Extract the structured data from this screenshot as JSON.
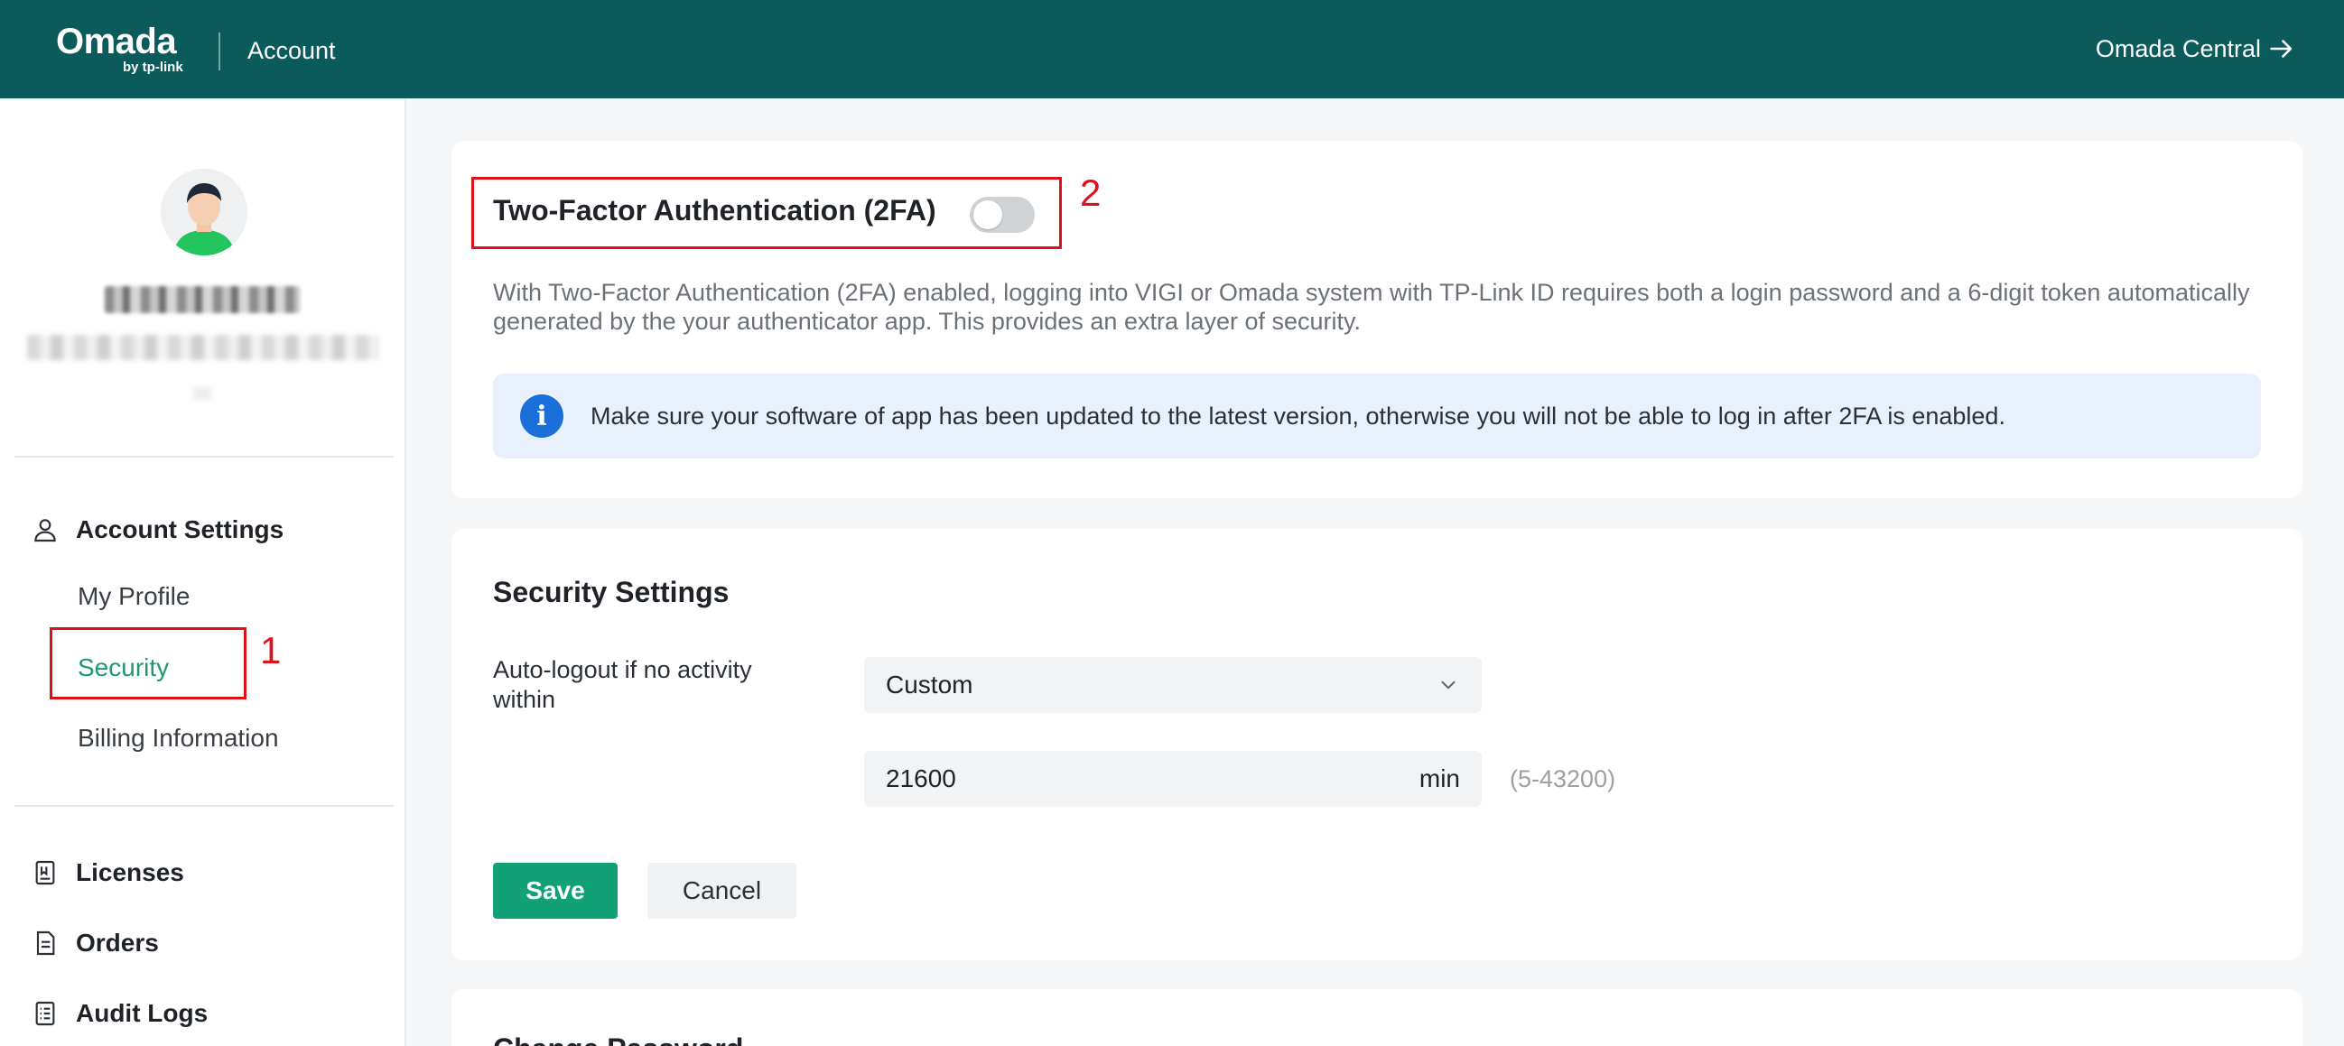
{
  "header": {
    "brand": "Omada",
    "brand_sub": "by tp-link",
    "section": "Account",
    "central_link": "Omada Central"
  },
  "sidebar": {
    "groups": [
      {
        "label": "Account Settings",
        "icon": "user-icon"
      }
    ],
    "items": [
      {
        "label": "My Profile"
      },
      {
        "label": "Security",
        "active": true
      },
      {
        "label": "Billing Information"
      }
    ],
    "links": [
      {
        "label": "Licenses",
        "icon": "license-icon"
      },
      {
        "label": "Orders",
        "icon": "document-icon"
      },
      {
        "label": "Audit Logs",
        "icon": "list-icon"
      }
    ]
  },
  "annotations": {
    "mark_1": "1",
    "mark_2": "2"
  },
  "twofa": {
    "title": "Two-Factor Authentication (2FA)",
    "enabled": false,
    "description": "With Two-Factor Authentication (2FA) enabled, logging into VIGI or Omada system with TP-Link ID requires both a login password and a 6-digit token automatically generated by the your authenticator app. This provides an extra layer of security.",
    "notice": "Make sure your software of app has been updated to the latest version, otherwise you will not be able to log in after 2FA is enabled."
  },
  "security_settings": {
    "title": "Security Settings",
    "auto_logout_label": "Auto-logout if no activity within",
    "auto_logout_selected": "Custom",
    "minutes_value": "21600",
    "minutes_unit": "min",
    "range_hint": "(5-43200)",
    "save_label": "Save",
    "cancel_label": "Cancel"
  },
  "change_password": {
    "title": "Change Password"
  },
  "colors": {
    "header_bg": "#0b5b5c",
    "accent_green": "#12a176",
    "active_text": "#1d9a73",
    "highlight_red": "#e0101a",
    "notice_bg": "#e7f0fb",
    "info_blue": "#1a6fd8"
  }
}
